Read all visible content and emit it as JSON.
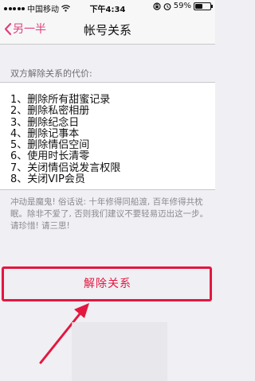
{
  "status_bar": {
    "carrier": "中国移动",
    "time": "下午4:34",
    "battery": "59%",
    "battery_level": 0.59,
    "icons": [
      "signal-icon",
      "wifi-icon",
      "lock-rotation-icon",
      "alarm-icon",
      "battery-icon"
    ]
  },
  "nav": {
    "back_label": "另一半",
    "title": "帐号关系"
  },
  "section_header": "双方解除关系的代价:",
  "costs": [
    "1、删除所有甜蜜记录",
    "2、删除私密相册",
    "3、删除纪念日",
    "4、删除记事本",
    "5、删除情侣空间",
    "6、使用时长清零",
    "7、关闭情侣说发言权限",
    "8、关闭VIP会员"
  ],
  "warning": "冲动是魔鬼! 俗话说: 十年修得同船渡, 百年修得共枕眠。除非不爱了, 否则我们建议不要轻易迈出这一步。请珍惜! 请三思!",
  "action": {
    "dissolve_label": "解除关系"
  },
  "colors": {
    "accent": "#e0407a",
    "danger": "#e3173f",
    "background": "#efeff4"
  }
}
